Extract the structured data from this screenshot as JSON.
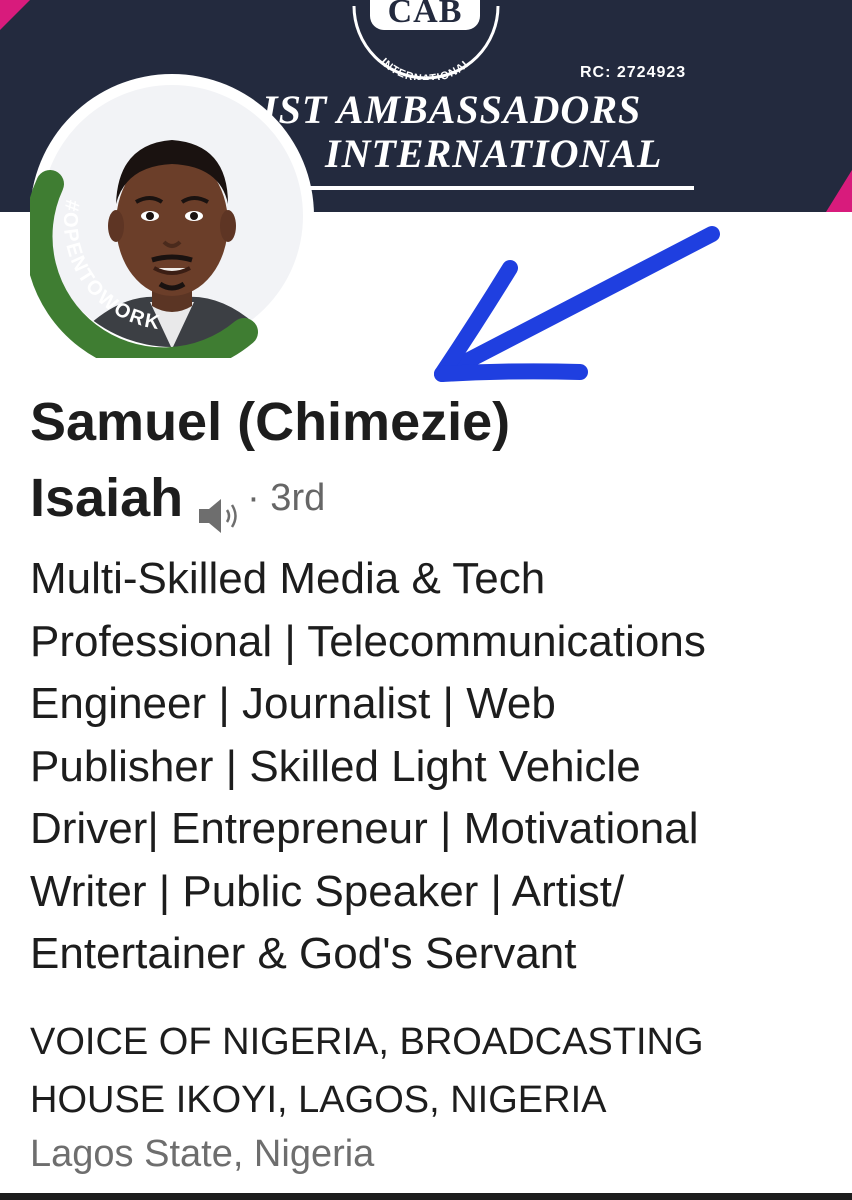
{
  "banner": {
    "logo_text": "CAB",
    "logo_ring_text": "INTERNATIONAL",
    "rc_number": "RC: 2724923",
    "org_line1": "IST AMBASSADORS",
    "org_line2": "INTERNATIONAL"
  },
  "profile": {
    "open_to_work_badge": "#OPENTOWORK",
    "name_line1": "Samuel (Chimezie)",
    "name_line2": "Isaiah",
    "connection_degree": "· 3rd",
    "headline": "Multi-Skilled Media & Tech\nProfessional | Telecommunications\nEngineer | Journalist | Web\nPublisher | Skilled Light Vehicle\nDriver|  Entrepreneur | Motivational\nWriter | Public Speaker | Artist/\nEntertainer & God's Servant",
    "company": "VOICE OF NIGERIA, BROADCASTING\nHOUSE IKOYI, LAGOS, NIGERIA",
    "location": "Lagos State, Nigeria"
  },
  "colors": {
    "banner_bg": "#232a3e",
    "banner_accent": "#d81b7c",
    "open_to_work_ring": "#3f7d32",
    "annotation_arrow": "#1f3fe0",
    "text_primary": "#1d1d1d",
    "text_secondary": "#6e6e6e"
  },
  "icons": {
    "speaker": "speaker-icon",
    "arrow": "annotation-arrow"
  }
}
